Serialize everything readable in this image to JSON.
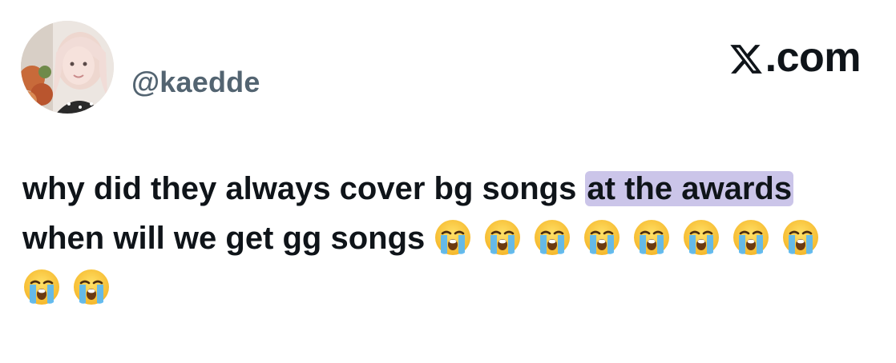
{
  "author": {
    "handle": "@kaedde",
    "avatar_icon": "profile-photo-avatar"
  },
  "brand": {
    "label": ".com",
    "logo_icon": "x-logo-icon"
  },
  "tweet": {
    "text_before": "why did they always cover bg songs ",
    "highlighted": "at the awards",
    "text_after": " when will we get gg songs",
    "emoji_icon": "loudly-crying-face-emoji",
    "emoji_count": 10
  },
  "colors": {
    "text": "#0f1419",
    "handle": "#536471",
    "highlight": "#a096d7"
  }
}
